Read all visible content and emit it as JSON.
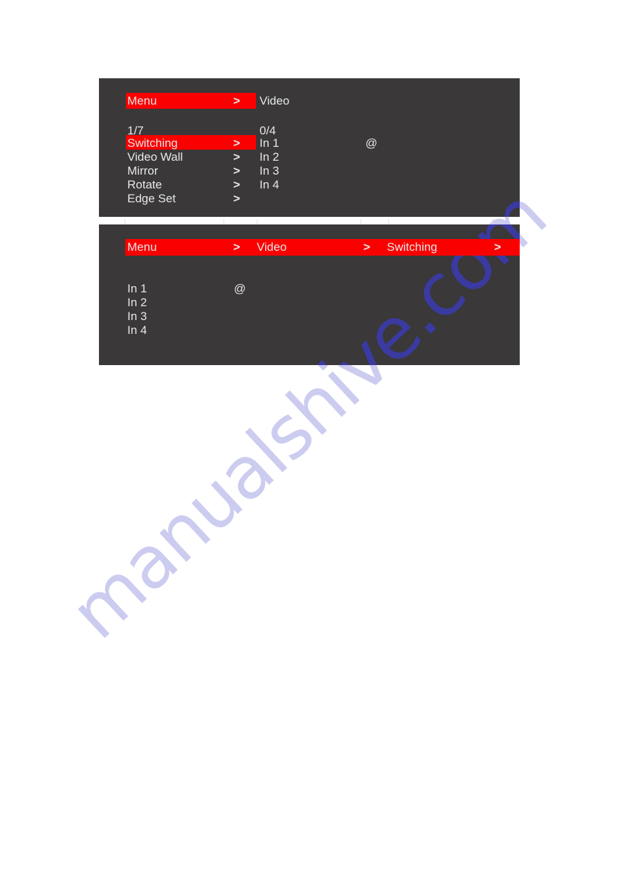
{
  "page": {
    "background_color": "#ffffff",
    "watermark_text": "manualshive.com",
    "watermark_color": "#ccccf0",
    "watermark_color_on_panel": "#3a3aa0"
  },
  "theme": {
    "panel_background": "#3a3838",
    "highlight_color": "#fa0000",
    "text_color": "#e8e8e8"
  },
  "panel_one": {
    "breadcrumb": {
      "current": "Menu",
      "chevron": ">",
      "next": "Video"
    },
    "left_column": {
      "counter": "1/7",
      "items": [
        {
          "label": "Switching",
          "chevron": ">",
          "selected": true
        },
        {
          "label": "Video Wall",
          "chevron": ">",
          "selected": false
        },
        {
          "label": "Mirror",
          "chevron": ">",
          "selected": false
        },
        {
          "label": "Rotate",
          "chevron": ">",
          "selected": false
        },
        {
          "label": "Edge Set",
          "chevron": ">",
          "selected": false
        }
      ]
    },
    "right_column": {
      "counter": "0/4",
      "items": [
        {
          "label": "In 1",
          "marker": "@"
        },
        {
          "label": "In 2",
          "marker": ""
        },
        {
          "label": "In 3",
          "marker": ""
        },
        {
          "label": "In 4",
          "marker": ""
        }
      ]
    }
  },
  "panel_two": {
    "breadcrumb": {
      "crumb_one": "Menu",
      "chevron_one": ">",
      "crumb_two": "Video",
      "chevron_two": ">",
      "crumb_three": "Switching",
      "chevron_three": ">"
    },
    "input_list": {
      "items": [
        {
          "label": "In 1",
          "marker": "@"
        },
        {
          "label": "In 2",
          "marker": ""
        },
        {
          "label": "In 3",
          "marker": ""
        },
        {
          "label": "In 4",
          "marker": ""
        }
      ]
    }
  }
}
